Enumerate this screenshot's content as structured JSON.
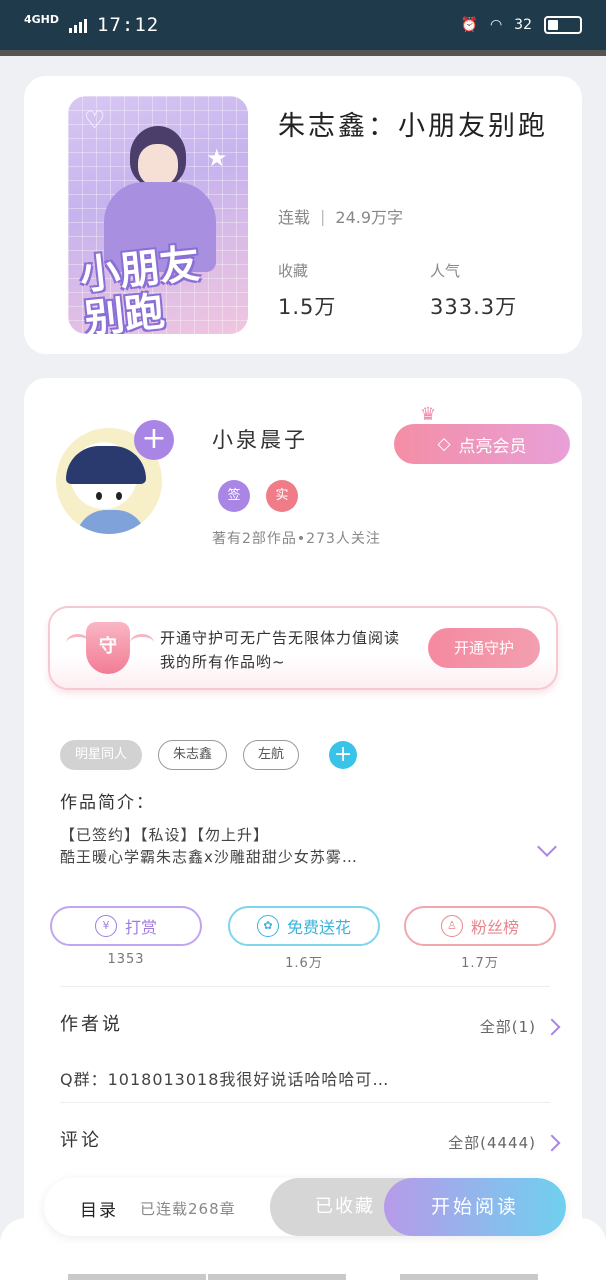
{
  "status_bar": {
    "network": "4GHD",
    "time": "17:12",
    "battery_text": "32",
    "battery_level": 0.32
  },
  "book": {
    "title": "朱志鑫：小朋友别跑",
    "status": "连载",
    "word_count": "24.9万字",
    "favorites_label": "收藏",
    "favorites_value": "1.5万",
    "popularity_label": "人气",
    "popularity_value": "333.3万",
    "cover_art_text": "小朋友别跑"
  },
  "author": {
    "name": "小泉晨子",
    "vip_label": "点亮会员",
    "badge_sign": "签",
    "badge_real": "实",
    "stats": "著有2部作品•273人关注"
  },
  "guard": {
    "shield_text": "守",
    "text": "开通守护可无广告无限体力值阅读我的所有作品哟~",
    "button": "开通守护"
  },
  "tags": [
    "明星同人",
    "朱志鑫",
    "左航"
  ],
  "intro": {
    "label": "作品简介：",
    "line1": "【已签约】【私设】【勿上升】",
    "line2": "酷王暖心学霸朱志鑫x沙雕甜甜少女苏雾…"
  },
  "actions": [
    {
      "label": "打赏",
      "count": "1353",
      "icon": "yen-icon"
    },
    {
      "label": "免费送花",
      "count": "1.6万",
      "icon": "flower-icon"
    },
    {
      "label": "粉丝榜",
      "count": "1.7万",
      "icon": "user-icon"
    }
  ],
  "author_says": {
    "title": "作者说",
    "more": "全部(1)",
    "text": "Q群：1018013018我很好说话哈哈哈可…"
  },
  "comments": {
    "title": "评论",
    "more": "全部(4444)"
  },
  "bottom": {
    "toc": "目录",
    "chapters": "已连载268章",
    "saved": "已收藏",
    "read": "开始阅读"
  },
  "colors": {
    "accent_purple": "#a985e6",
    "accent_pink": "#f48ea5",
    "accent_cyan": "#3ac3e8"
  }
}
